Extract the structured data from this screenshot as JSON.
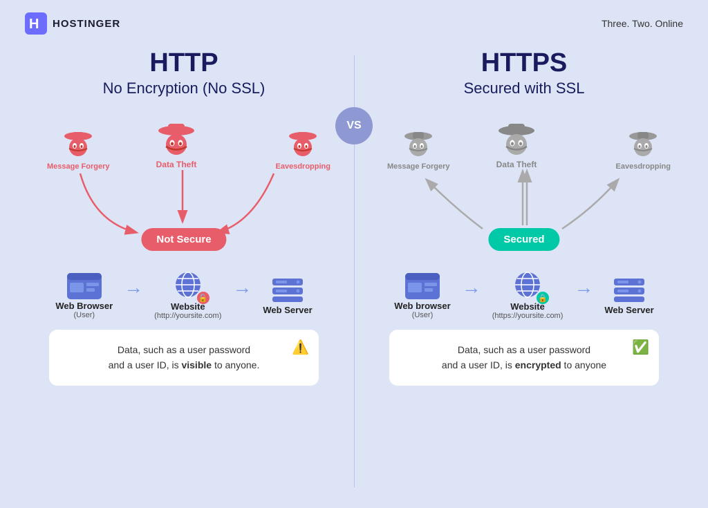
{
  "header": {
    "logo_text": "HOSTINGER",
    "tagline": "Three. Two. Online"
  },
  "vs_label": "VS",
  "left_panel": {
    "title": "HTTP",
    "subtitle": "No Encryption (No SSL)",
    "threats": [
      {
        "label": "Message Forgery",
        "position": "left"
      },
      {
        "label": "Data Theft",
        "position": "center"
      },
      {
        "label": "Eavesdropping",
        "position": "right"
      }
    ],
    "badge": "Not Secure",
    "infra": [
      {
        "label": "Web Browser",
        "sub": "(User)"
      },
      {
        "label": "Website",
        "sub": "(http://yoursite.com)"
      },
      {
        "label": "Web Server",
        "sub": ""
      }
    ],
    "info_text_1": "Data, such as a user password",
    "info_text_2": "and a user ID, is ",
    "info_bold": "visible",
    "info_text_3": " to anyone.",
    "info_icon": "⚠️"
  },
  "right_panel": {
    "title": "HTTPS",
    "subtitle": "Secured with SSL",
    "threats": [
      {
        "label": "Message Forgery",
        "position": "left"
      },
      {
        "label": "Data Theft",
        "position": "center"
      },
      {
        "label": "Eavesdropping",
        "position": "right"
      }
    ],
    "badge": "Secured",
    "infra": [
      {
        "label": "Web browser",
        "sub": "(User)"
      },
      {
        "label": "Website",
        "sub": "(https://yoursite.com)"
      },
      {
        "label": "Web Server",
        "sub": ""
      }
    ],
    "info_text_1": "Data, such as a user password",
    "info_text_2": "and a user ID, is ",
    "info_bold": "encrypted",
    "info_text_3": " to anyone",
    "info_icon": "✅"
  }
}
